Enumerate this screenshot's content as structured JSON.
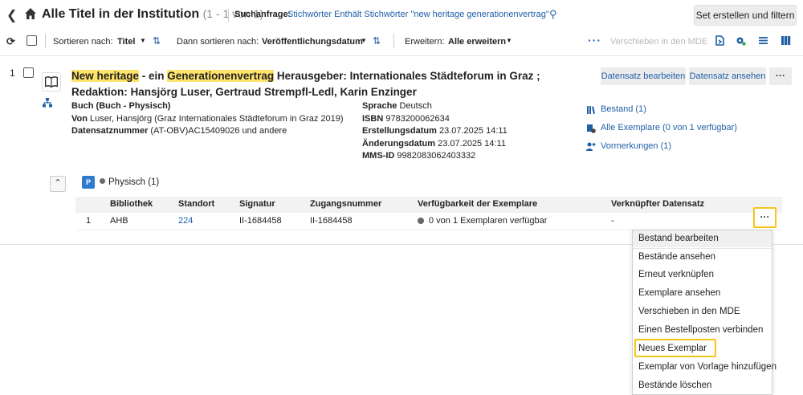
{
  "header": {
    "title": "Alle Titel in der Institution",
    "count": "(1 - 1 von 1)",
    "query_label": "Suchanfrage:",
    "query_value": "Stichwörter Enthält Stichwörter \"new heritage generationenvertrag\"",
    "set_button": "Set erstellen und filtern"
  },
  "toolbar": {
    "sort1_label": "Sortieren nach:",
    "sort1_value": "Titel",
    "sort2_label": "Dann sortieren nach:",
    "sort2_value": "Veröffentlichungsdatum",
    "expand_label": "Erweitern:",
    "expand_value": "Alle erweitern",
    "more": "···",
    "move_mde": "Verschieben in den MDE"
  },
  "record": {
    "number": "1",
    "title_hl1": "New heritage",
    "title_mid": " - ein ",
    "title_hl2": "Generationenvertrag",
    "title_rest": " Herausgeber: Internationales Städteforum in Graz ; Redaktion: Hansjörg Luser, Gertraud Strempfl-Ledl, Karin Enzinger",
    "edit_button": "Datensatz bearbeiten",
    "view_button": "Datensatz ansehen",
    "more_button": "···",
    "type": "Buch (Buch - Physisch)",
    "by_label": "Von",
    "by_value": "Luser, Hansjörg (Graz Internationales Städteforum in Graz 2019)",
    "recnum_label": "Datensatznummer",
    "recnum_value": "(AT-OBV)AC15409026 und andere",
    "lang_label": "Sprache",
    "lang_value": "Deutsch",
    "isbn_label": "ISBN",
    "isbn_value": "9783200062634",
    "created_label": "Erstellungsdatum",
    "created_value": "23.07.2025 14:11",
    "modified_label": "Änderungsdatum",
    "modified_value": "23.07.2025 14:11",
    "mms_label": "MMS-ID",
    "mms_value": "9982083062403332",
    "link_holdings": "Bestand (1)",
    "link_items": "Alle Exemplare (0 von 1 verfügbar)",
    "link_requests": "Vormerkungen (1)"
  },
  "holdings": {
    "badge": "P",
    "label": "Physisch (1)",
    "columns": [
      "Bibliothek",
      "Standort",
      "Signatur",
      "Zugangsnummer",
      "Verfügbarkeit der Exemplare",
      "Verknüpfter Datensatz"
    ],
    "row": {
      "index": "1",
      "library": "AHB",
      "location": "224",
      "call_number": "II-1684458",
      "accession": "II-1684458",
      "availability": "0 von 1 Exemplaren verfügbar",
      "linked": "-"
    },
    "row_more": "···"
  },
  "menu": {
    "items": [
      "Bestand bearbeiten",
      "Bestände ansehen",
      "Erneut verknüpfen",
      "Exemplare ansehen",
      "Verschieben in den MDE",
      "Einen Bestellposten verbinden",
      "Neues Exemplar",
      "Exemplar von Vorlage hinzufügen",
      "Bestände löschen"
    ]
  },
  "colors": {
    "link": "#1f5fa8",
    "highlight": "#ffe36b",
    "focus_outline": "#f5c518",
    "physical_badge": "#2f7bd0"
  },
  "icons": [
    "back-icon",
    "home-icon",
    "query-edit-icon",
    "refresh-icon",
    "sort-direction-icon",
    "book-icon",
    "hierarchy-icon",
    "library-icon",
    "items-icon",
    "requests-icon",
    "collapse-icon"
  ]
}
